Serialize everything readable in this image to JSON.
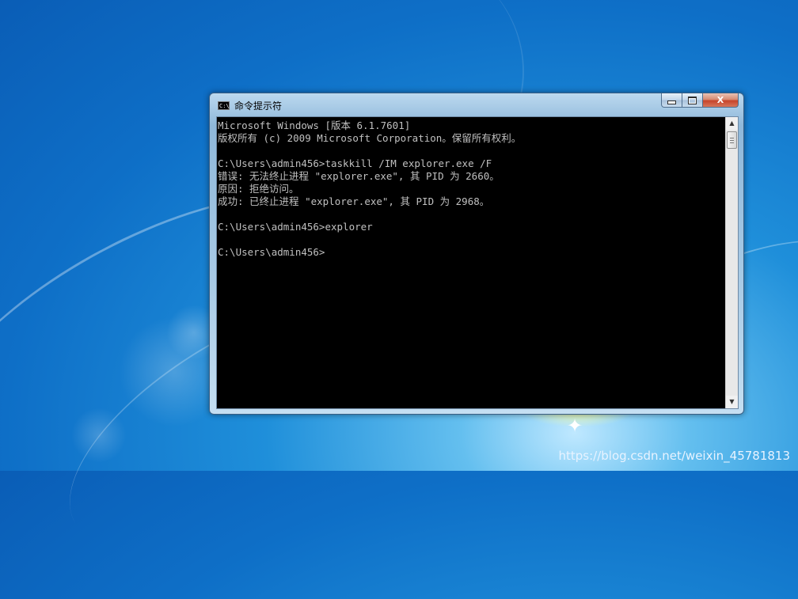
{
  "window": {
    "title": "命令提示符",
    "controls": {
      "minimize": "minimize",
      "maximize": "maximize",
      "close": "X"
    }
  },
  "console": {
    "lines": [
      "Microsoft Windows [版本 6.1.7601]",
      "版权所有 (c) 2009 Microsoft Corporation。保留所有权利。",
      "",
      "C:\\Users\\admin456>taskkill /IM explorer.exe /F",
      "错误: 无法终止进程 \"explorer.exe\", 其 PID 为 2660。",
      "原因: 拒绝访问。",
      "成功: 已终止进程 \"explorer.exe\", 其 PID 为 2968。",
      "",
      "C:\\Users\\admin456>explorer",
      "",
      "C:\\Users\\admin456>"
    ],
    "text_color": "#c0c0c0",
    "background": "#000000"
  },
  "watermark": "https://blog.csdn.net/weixin_45781813",
  "icons": {
    "window_icon": "cmd-icon",
    "desktop_sparkle": "sparkle-icon"
  }
}
